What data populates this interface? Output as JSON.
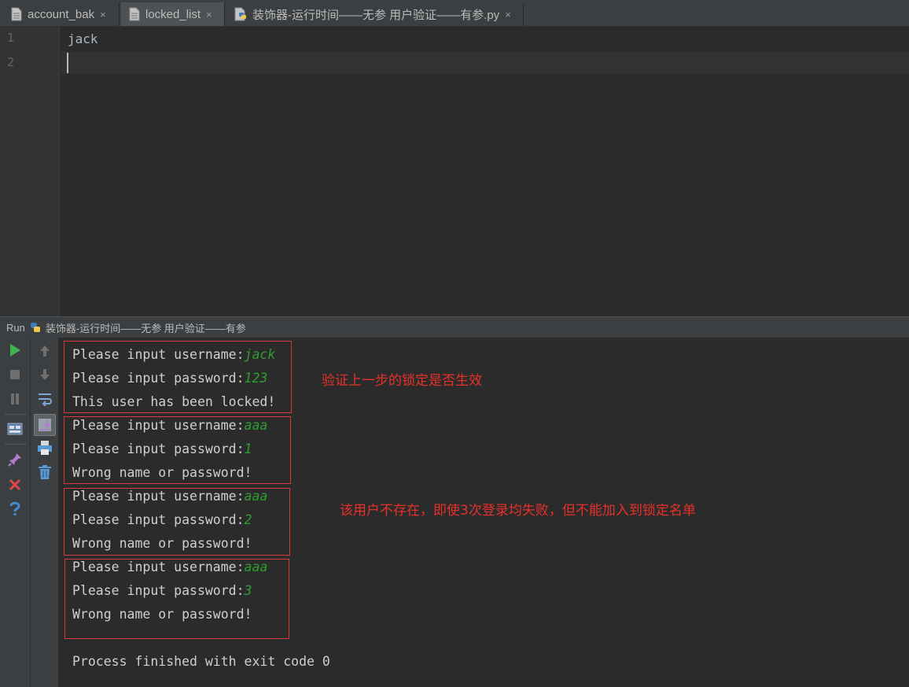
{
  "tabs": [
    {
      "label": "account_bak",
      "close": "×",
      "icon": "text-file-icon",
      "active": false
    },
    {
      "label": "locked_list",
      "close": "×",
      "icon": "text-file-icon",
      "active": true
    },
    {
      "label": "装饰器-运行时间——无参 用户验证——有参.py",
      "close": "×",
      "icon": "python-file-icon",
      "active": false
    }
  ],
  "editor": {
    "line_numbers": [
      "1",
      "2"
    ],
    "lines": [
      "jack",
      ""
    ]
  },
  "run": {
    "label": "Run",
    "config_name": "装饰器-运行时间——无参 用户验证——有参"
  },
  "console": {
    "prompt_user": "Please input username:",
    "prompt_pass": "Please input password:",
    "attempts": [
      {
        "username": "jack",
        "password": "123",
        "result": "This user has been locked!"
      },
      {
        "username": "aaa",
        "password": "1",
        "result": "Wrong name or password!"
      },
      {
        "username": "aaa",
        "password": "2",
        "result": "Wrong name or password!"
      },
      {
        "username": "aaa",
        "password": "3",
        "result": "Wrong name or password!"
      }
    ],
    "exit_message": "Process finished with exit code 0"
  },
  "annotations": {
    "note1": "验证上一步的锁定是否生效",
    "note2": "该用户不存在，即使3次登录均失败，但不能加入到锁定名单"
  },
  "colors": {
    "accent_red": "#d63a3a",
    "user_input_green": "#2f9e2f",
    "run_green": "#3fb34f"
  }
}
